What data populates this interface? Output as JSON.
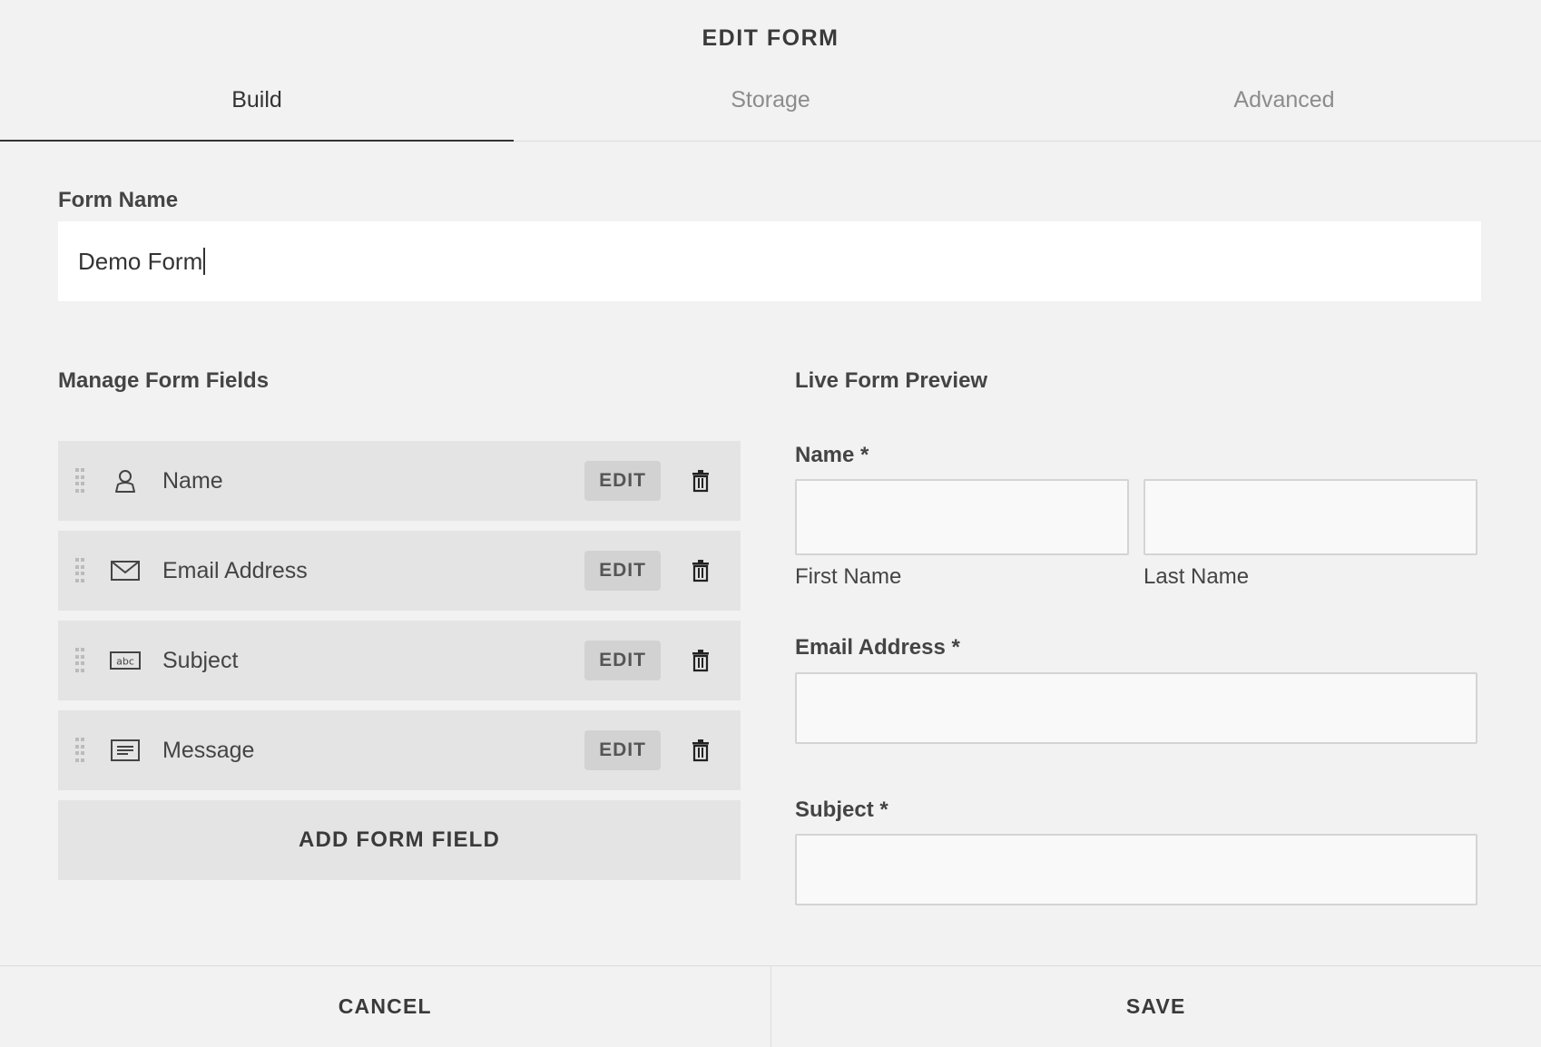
{
  "header": {
    "title": "EDIT FORM",
    "tabs": [
      {
        "label": "Build",
        "active": true
      },
      {
        "label": "Storage",
        "active": false
      },
      {
        "label": "Advanced",
        "active": false
      }
    ]
  },
  "form_name": {
    "label": "Form Name",
    "value": "Demo Form"
  },
  "manage": {
    "title": "Manage Form Fields",
    "fields": [
      {
        "label": "Name",
        "icon": "person-icon",
        "edit_label": "EDIT"
      },
      {
        "label": "Email Address",
        "icon": "envelope-icon",
        "edit_label": "EDIT"
      },
      {
        "label": "Subject",
        "icon": "abc-text-icon",
        "edit_label": "EDIT"
      },
      {
        "label": "Message",
        "icon": "textarea-icon",
        "edit_label": "EDIT"
      }
    ],
    "add_label": "ADD FORM FIELD"
  },
  "preview": {
    "title": "Live Form Preview",
    "name_label": "Name *",
    "first_name": "First Name",
    "last_name": "Last Name",
    "email_label": "Email Address *",
    "subject_label": "Subject *"
  },
  "footer": {
    "cancel": "CANCEL",
    "save": "SAVE"
  }
}
